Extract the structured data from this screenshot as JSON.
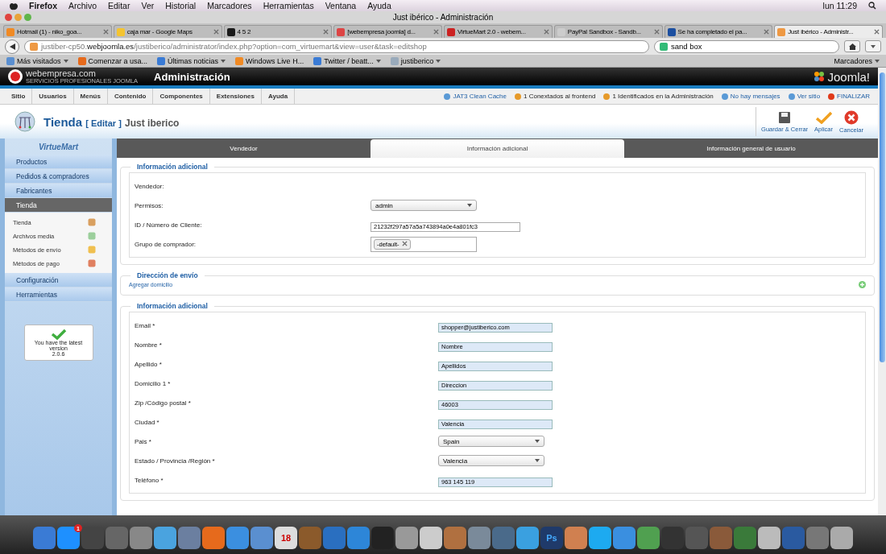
{
  "menubar": {
    "app": "Firefox",
    "menus": [
      "Archivo",
      "Editar",
      "Ver",
      "Historial",
      "Marcadores",
      "Herramientas",
      "Ventana",
      "Ayuda"
    ],
    "clock": "lun 11:29"
  },
  "browser": {
    "window_title": "Just ibérico - Administración",
    "tabs": [
      {
        "label": "Hotmail (1) - niko_goa...",
        "selected": false
      },
      {
        "label": "caja mar - Google Maps",
        "selected": false
      },
      {
        "label": "4 5 2",
        "selected": false
      },
      {
        "label": "[webempresa joomla] d...",
        "selected": false
      },
      {
        "label": "VirtueMart 2.0 - webem...",
        "selected": false
      },
      {
        "label": "PayPal Sandbox - Sandb...",
        "selected": false
      },
      {
        "label": "Se ha completado el pa...",
        "selected": false
      },
      {
        "label": "Just ibérico - Administr...",
        "selected": true
      }
    ],
    "url": {
      "prefix": "justiber-cp50.",
      "domain": "webjoomla.es",
      "path": "/justiberico/administrator/index.php?option=com_virtuemart&view=user&task=editshop"
    },
    "search": "sand box",
    "bookmarks": [
      {
        "label": "Más visitados",
        "dropdown": true
      },
      {
        "label": "Comenzar a usa...",
        "dropdown": false
      },
      {
        "label": "Últimas noticias",
        "dropdown": true
      },
      {
        "label": "Windows Live H...",
        "dropdown": false
      },
      {
        "label": "Twitter / beatt...",
        "dropdown": true
      },
      {
        "label": "justiberico",
        "dropdown": true
      }
    ],
    "bookmarks_menu": "Marcadores"
  },
  "admin": {
    "brand": "webempresa.com",
    "brand_tagline": "SERVICIOS PROFESIONALES JOOMLA",
    "header_title": "Administración",
    "cms_logo": "Joomla!",
    "menu": [
      "Sitio",
      "Usuarios",
      "Menús",
      "Contenido",
      "Componentes",
      "Extensiones",
      "Ayuda"
    ],
    "status": [
      {
        "label": "JAT3 Clean Cache",
        "kind": "link"
      },
      {
        "label": "1 Conextados al frontend",
        "kind": "text"
      },
      {
        "label": "1 Identificados en la Administración",
        "kind": "text"
      },
      {
        "label": "No hay mensajes",
        "kind": "link"
      },
      {
        "label": "Ver sitio",
        "kind": "link"
      },
      {
        "label": "FINALIZAR",
        "kind": "logout"
      }
    ],
    "page_title": {
      "title": "Tienda",
      "action": "[ Editar ]",
      "name": "Just iberico"
    },
    "toolbar": [
      {
        "label": "Guardar & Cerrar",
        "kind": "save"
      },
      {
        "label": "Aplicar",
        "kind": "apply"
      },
      {
        "label": "Cancelar",
        "kind": "cancel"
      }
    ]
  },
  "sidebar": {
    "logo": "VirtueMart",
    "items": [
      {
        "label": "Productos",
        "selected": false
      },
      {
        "label": "Pedidos & compradores",
        "selected": false
      },
      {
        "label": "Fabricantes",
        "selected": false
      },
      {
        "label": "Tienda",
        "selected": true,
        "children": [
          {
            "label": "Tienda"
          },
          {
            "label": "Archivos media"
          },
          {
            "label": "Métodos de envío"
          },
          {
            "label": "Métodos de pago"
          }
        ]
      },
      {
        "label": "Configuración",
        "selected": false
      },
      {
        "label": "Herramientas",
        "selected": false
      }
    ],
    "update": {
      "message": "You have the latest version",
      "version": "2.0.6"
    }
  },
  "content": {
    "tabs": [
      {
        "label": "Vendedor",
        "selected": false
      },
      {
        "label": "Información adicional",
        "selected": true
      },
      {
        "label": "Información general de usuario",
        "selected": false
      }
    ],
    "sections": [
      {
        "legend": "Información adicional",
        "fields": [
          {
            "label": "Vendedor:",
            "kind": "none"
          },
          {
            "label": "Permisos:",
            "kind": "select",
            "value": "admin"
          },
          {
            "label": "ID / Número de Cliente:",
            "kind": "plain",
            "value": "21232f297a57a5a743894a0e4a801fc3"
          },
          {
            "label": "Grupo de comprador:",
            "kind": "tags",
            "value": "-default-"
          }
        ]
      },
      {
        "legend": "Dirección de envío",
        "link": "Agregar domicilio"
      },
      {
        "legend": "Información adicional",
        "fields": [
          {
            "label": "Email *",
            "kind": "input",
            "value": "shopper@justiberico.com"
          },
          {
            "label": "Nombre *",
            "kind": "input",
            "value": "Nombre"
          },
          {
            "label": "Apellido *",
            "kind": "input",
            "value": "Apellidos"
          },
          {
            "label": "Domicilio 1 *",
            "kind": "input",
            "value": "Direccion"
          },
          {
            "label": "Zip /Código postal *",
            "kind": "input",
            "value": "46003"
          },
          {
            "label": "Ciudad *",
            "kind": "input",
            "value": "Valencia"
          },
          {
            "label": "Pais *",
            "kind": "select",
            "value": "Spain"
          },
          {
            "label": "Estado / Provincia /Región *",
            "kind": "select",
            "value": "Valencia"
          },
          {
            "label": "Teléfono *",
            "kind": "input",
            "value": "963 145 119"
          }
        ]
      }
    ]
  },
  "dock": [
    {
      "color": "#3a7bd5"
    },
    {
      "color": "#1e90ff",
      "badge": "1"
    },
    {
      "color": "#444444"
    },
    {
      "color": "#666666"
    },
    {
      "color": "#888888"
    },
    {
      "color": "#4aa3df"
    },
    {
      "color": "#6b7fa0"
    },
    {
      "color": "#e66a1c"
    },
    {
      "color": "#3b8fe0"
    },
    {
      "color": "#5a8fd0"
    },
    {
      "color": "#dddddd",
      "label": "18"
    },
    {
      "color": "#8b5a2b"
    },
    {
      "color": "#2a6fc0"
    },
    {
      "color": "#2d86d8"
    },
    {
      "color": "#222222"
    },
    {
      "color": "#999999"
    },
    {
      "color": "#cccccc"
    },
    {
      "color": "#b07040"
    },
    {
      "color": "#7a8a9a"
    },
    {
      "color": "#4a6a8a"
    },
    {
      "color": "#3aa0e0"
    },
    {
      "color": "#1f3a6a",
      "label": "Ps"
    },
    {
      "color": "#d08050"
    },
    {
      "color": "#1daaf0"
    },
    {
      "color": "#3a8fe0"
    },
    {
      "color": "#50a050"
    },
    {
      "color": "#333333"
    },
    {
      "color": "#555555"
    },
    {
      "color": "#8a5a3a"
    },
    {
      "color": "#3a7a3a"
    },
    {
      "color": "#bbbbbb"
    },
    {
      "color": "#2a5aa0"
    },
    {
      "color": "#777777"
    },
    {
      "color": "#aaaaaa"
    }
  ]
}
